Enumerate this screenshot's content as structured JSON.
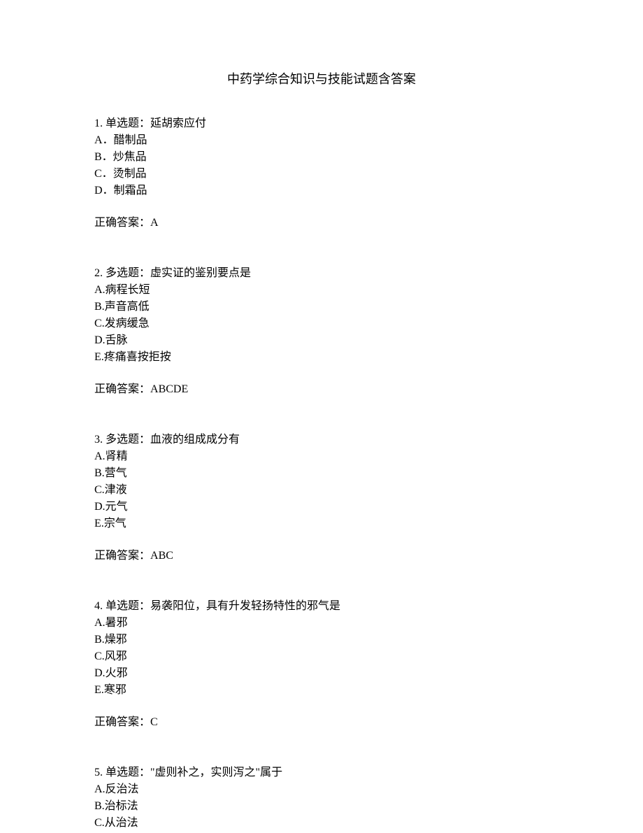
{
  "title": "中药学综合知识与技能试题含答案",
  "questions": [
    {
      "number": "1.",
      "type": "单选题：",
      "stem": "延胡索应付",
      "options": [
        "A．醋制品",
        "B．炒焦品",
        "C．烫制品",
        "D．制霜品"
      ],
      "answer_label": "正确答案：",
      "answer": "A"
    },
    {
      "number": "2.",
      "type": "多选题：",
      "stem": "虚实证的鉴别要点是",
      "options": [
        "A.病程长短",
        "B.声音高低",
        "C.发病缓急",
        "D.舌脉",
        "E.疼痛喜按拒按"
      ],
      "answer_label": "正确答案：",
      "answer": "ABCDE"
    },
    {
      "number": "3.",
      "type": "多选题：",
      "stem": "血液的组成成分有",
      "options": [
        "A.肾精",
        "B.营气",
        "C.津液",
        "D.元气",
        "E.宗气"
      ],
      "answer_label": "正确答案：",
      "answer": "ABC"
    },
    {
      "number": "4.",
      "type": "单选题：",
      "stem": "易袭阳位，具有升发轻扬特性的邪气是",
      "options": [
        "A.暑邪",
        "B.燥邪",
        "C.风邪",
        "D.火邪",
        "E.寒邪"
      ],
      "answer_label": "正确答案：",
      "answer": "C"
    },
    {
      "number": "5.",
      "type": "单选题：",
      "stem": "\"虚则补之，实则泻之\"属于",
      "options": [
        "A.反治法",
        "B.治标法",
        "C.从治法"
      ],
      "answer_label": "",
      "answer": ""
    }
  ]
}
